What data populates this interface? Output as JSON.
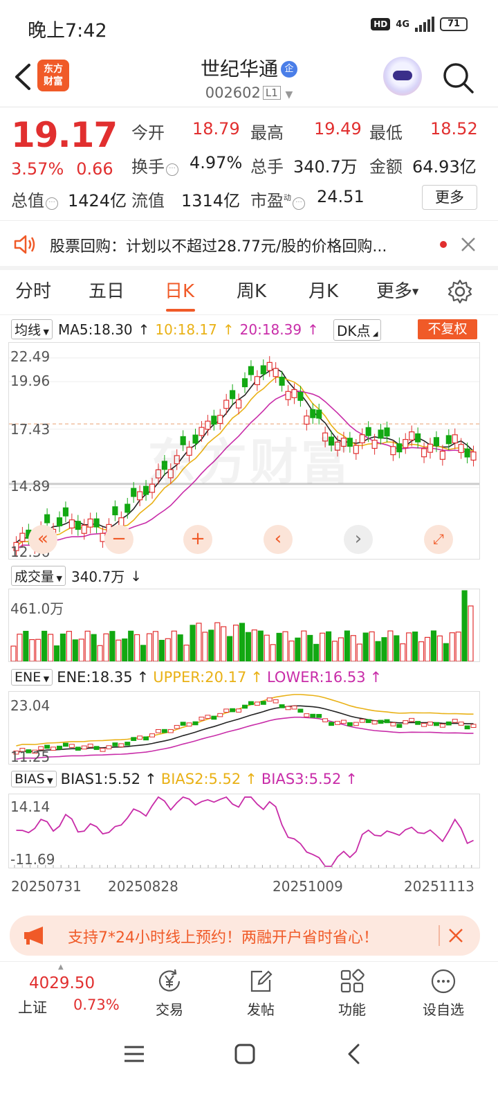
{
  "status_bar": {
    "time": "晚上7:42",
    "hd": "HD",
    "network": "4G",
    "battery": "71"
  },
  "header": {
    "logo_line1": "东方",
    "logo_line2": "财富",
    "stock_name": "世纪华通",
    "badge": "企",
    "stock_code": "002602",
    "level": "L1"
  },
  "quote": {
    "price": "19.17",
    "change_pct": "3.57%",
    "change": "0.66",
    "open_label": "今开",
    "open": "18.79",
    "high_label": "最高",
    "high": "19.49",
    "low_label": "最低",
    "low": "18.52",
    "turnover_label": "换手",
    "turnover": "4.97%",
    "volume_label": "总手",
    "volume": "340.7万",
    "amount_label": "金额",
    "amount": "64.93亿",
    "mcap_label": "总值",
    "mcap": "1424亿",
    "float_label": "流值",
    "float_mcap": "1314亿",
    "pe_label": "市盈",
    "pe_sup": "动",
    "pe": "24.51",
    "more_button": "更多"
  },
  "notice": {
    "text": "股票回购：计划以不超过28.77元/股的价格回购..."
  },
  "tabs": [
    "分时",
    "五日",
    "日K",
    "周K",
    "月K",
    "更多"
  ],
  "active_tab": "日K",
  "kline": {
    "indicator_select": "均线",
    "ma5": "MA5:18.30",
    "ma10": "10:18.17",
    "ma20": "20:18.39",
    "dk_select": "DK点",
    "adjust_button": "不复权",
    "y_ticks": [
      "22.49",
      "19.96",
      "17.43",
      "14.89",
      "12.36"
    ],
    "watermark": "东方财富"
  },
  "volume_panel": {
    "select": "成交量",
    "value": "340.7万",
    "max_label": "461.0万"
  },
  "ene_panel": {
    "select": "ENE",
    "ene": "ENE:18.35",
    "upper": "UPPER:20.17",
    "lower": "LOWER:16.53",
    "top": "23.04",
    "bottom": "11.25"
  },
  "bias_panel": {
    "select": "BIAS",
    "bias1": "BIAS1:5.52",
    "bias2": "BIAS2:5.52",
    "bias3": "BIAS3:5.52",
    "top": "14.14",
    "bottom": "-11.69"
  },
  "dates": [
    "20250731",
    "20250828",
    "20251009",
    "20251113"
  ],
  "promo": {
    "text": "支持7*24小时线上预约！两融开户省时省心！"
  },
  "bottom_nav": {
    "index_value": "4029.50",
    "index_name": "上证",
    "index_change": "0.73%",
    "items": [
      "交易",
      "发帖",
      "功能",
      "设自选"
    ]
  },
  "colors": {
    "up": "#e12f2f",
    "down": "#12a812",
    "accent": "#f05a28",
    "ma10": "#e9b116",
    "ma20": "#c82ca8"
  }
}
